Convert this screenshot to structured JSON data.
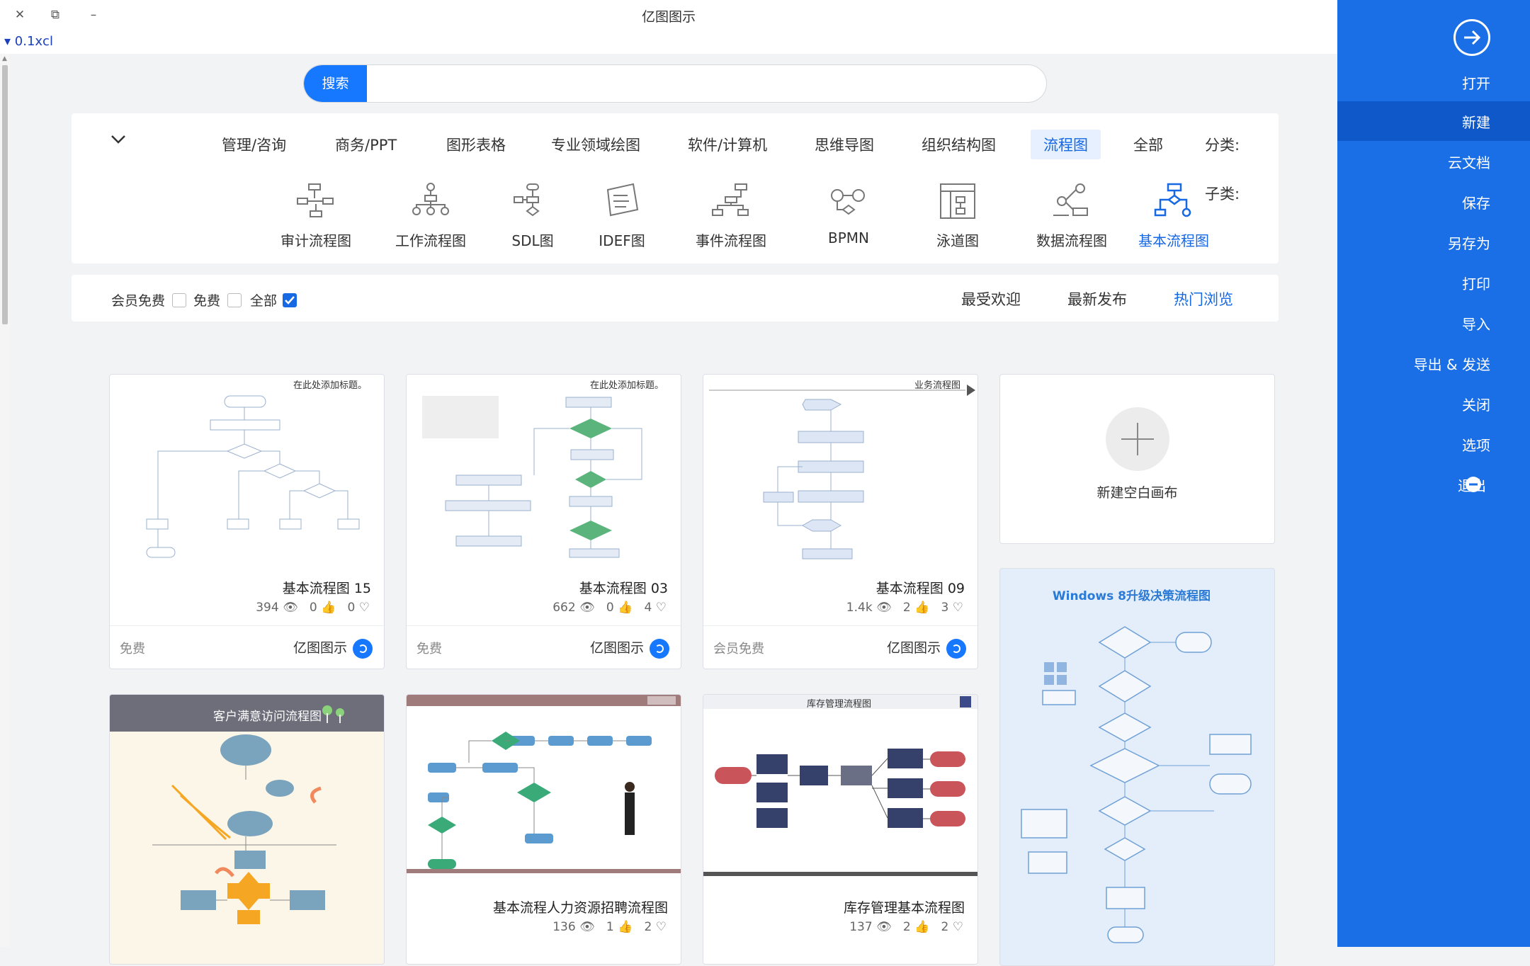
{
  "window": {
    "title": "亿图图示",
    "version": "0.1ⅹcl",
    "buttons": [
      "✕",
      "⧉",
      "–"
    ]
  },
  "search": {
    "button": "搜索",
    "placeholder": ""
  },
  "filter": {
    "category_label": "分类:",
    "subcategory_label": "子类:",
    "categories": [
      {
        "label": "全部"
      },
      {
        "label": "流程图",
        "active": true
      },
      {
        "label": "组织结构图"
      },
      {
        "label": "思维导图"
      },
      {
        "label": "软件/计算机"
      },
      {
        "label": "专业领域绘图"
      },
      {
        "label": "图形表格"
      },
      {
        "label": "商务/PPT"
      },
      {
        "label": "管理/咨询"
      }
    ],
    "subcategories": [
      {
        "label": "基本流程图",
        "icon": "basic-flowchart-icon",
        "active": true
      },
      {
        "label": "数据流程图",
        "icon": "data-flow-icon"
      },
      {
        "label": "泳道图",
        "icon": "swimlane-icon"
      },
      {
        "label": "BPMN",
        "icon": "bpmn-icon"
      },
      {
        "label": "事件流程图",
        "icon": "event-flow-icon"
      },
      {
        "label": "IDEF图",
        "icon": "idef-icon"
      },
      {
        "label": "SDL图",
        "icon": "sdl-icon"
      },
      {
        "label": "工作流程图",
        "icon": "workflow-icon"
      },
      {
        "label": "审计流程图",
        "icon": "audit-flow-icon"
      }
    ]
  },
  "sort": {
    "tabs": [
      {
        "label": "热门浏览",
        "active": true
      },
      {
        "label": "最新发布"
      },
      {
        "label": "最受欢迎"
      }
    ],
    "checks": [
      {
        "label": "全部",
        "checked": true
      },
      {
        "label": "免费",
        "checked": false
      },
      {
        "label": "会员免费",
        "checked": false
      }
    ]
  },
  "blank_card": {
    "label": "新建空白画布"
  },
  "templates": [
    {
      "title": "基本流程图 09",
      "views": "1.4k",
      "likes": "2",
      "favs": "3",
      "brand": "亿图图示",
      "price": "会员免费",
      "thumb_title": "业务流程图"
    },
    {
      "title": "基本流程图 03",
      "views": "662",
      "likes": "0",
      "favs": "4",
      "brand": "亿图图示",
      "price": "免费",
      "thumb_title": "在此处添加标题。"
    },
    {
      "title": "基本流程图 15",
      "views": "394",
      "likes": "0",
      "favs": "0",
      "brand": "亿图图示",
      "price": "免费",
      "thumb_title": "在此处添加标题。"
    },
    {
      "title": "Windows 8升级决策流程图"
    },
    {
      "title": "库存管理基本流程图",
      "views": "137",
      "likes": "2",
      "favs": "2",
      "thumb_title": "库存管理流程图"
    },
    {
      "title": "基本流程人力资源招聘流程图",
      "views": "136",
      "likes": "1",
      "favs": "2"
    },
    {
      "title": "客户满意访问流程图"
    }
  ],
  "sidebar": {
    "items": [
      {
        "label": "打开"
      },
      {
        "label": "新建",
        "active": true
      },
      {
        "label": "云文档"
      },
      {
        "label": "保存"
      },
      {
        "label": "另存为"
      },
      {
        "label": "打印"
      },
      {
        "label": "导入"
      },
      {
        "label": "导出 & 发送"
      },
      {
        "label": "关闭"
      },
      {
        "label": "选项"
      },
      {
        "label": "退出"
      }
    ]
  },
  "colors": {
    "accent": "#1677ff",
    "sidebar": "#1a6ee6",
    "sidebar_active": "#0f58c9"
  }
}
